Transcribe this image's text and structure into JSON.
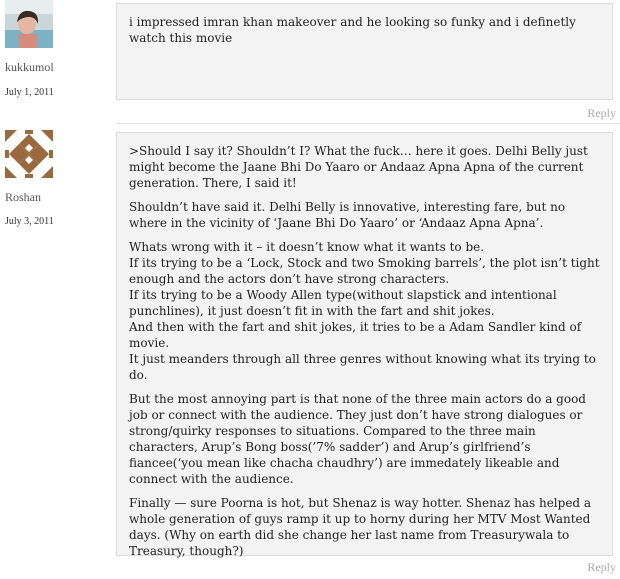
{
  "comments": [
    {
      "author": "kukkumol",
      "date": "July 1, 2011",
      "avatar": "photo-avatar",
      "paragraphs": [
        "i impressed imran khan makeover and he looking so funky and i definetly watch this movie"
      ],
      "reply_label": "Reply"
    },
    {
      "author": "Roshan",
      "date": "July 3, 2011",
      "avatar": "geometric-pattern-avatar",
      "paragraphs": [
        ">Should I say it? Shouldn’t I? What the fuck… here it goes. Delhi Belly just might become the Jaane Bhi Do Yaaro or Andaaz Apna Apna of the current generation. There, I said it!",
        "Shouldn’t have said it. Delhi Belly is innovative, interesting fare, but no where in the vicinity of ‘Jaane Bhi Do Yaaro’ or ‘Andaaz Apna Apna’.",
        "Whats wrong with it – it doesn’t know what it wants to be.\nIf its trying to be a ‘Lock, Stock and two Smoking barrels’, the plot isn’t tight enough and the actors don’t have strong characters.\nIf its trying to be a Woody Allen type(without slapstick and intentional punchlines), it just doesn’t fit in with the fart and shit jokes.\nAnd then with the fart and shit jokes, it tries to be a Adam Sandler kind of movie.\nIt just meanders through all three genres without knowing what its trying to do.",
        "But the most annoying part is that none of the three main actors do a good job or connect with the audience. They just don’t have strong dialogues or strong/quirky responses to situations. Compared to the three main characters, Arup’s Bong boss(’7% sadder’) and Arup’s girlfriend’s fiancee(‘you mean like chacha chaudhry’) are immedately likeable and connect with the audience.",
        "Finally — sure Poorna is hot, but Shenaz is way hotter. Shenaz has helped a whole generation of guys ramp it up to horny during her MTV Most Wanted days. (Why on earth did she change her last name from Treasurywala to Treasury, though?)"
      ],
      "reply_label": "Reply"
    }
  ],
  "colors": {
    "box_bg": "#f3f3f3",
    "box_border": "#dcdcdc",
    "reply": "#aaaaaa",
    "avatar_pattern": "#9a6a3e"
  }
}
